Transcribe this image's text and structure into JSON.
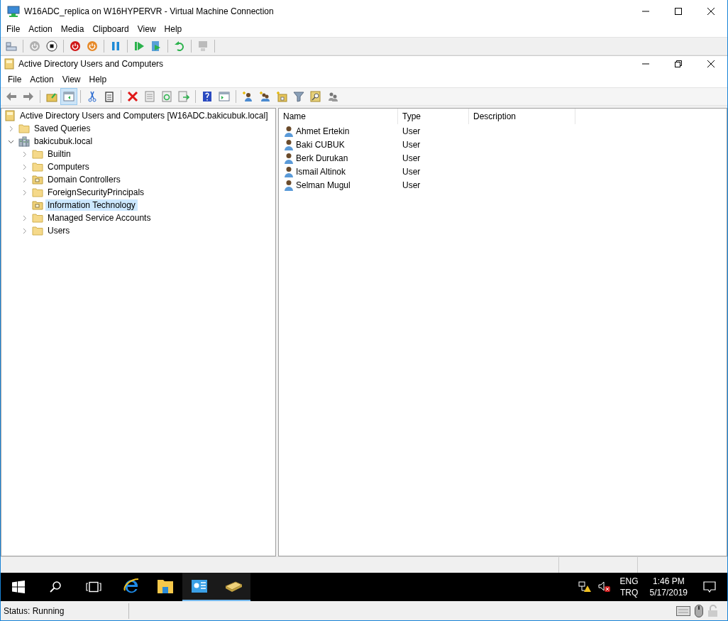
{
  "window": {
    "title": "W16ADC_replica on W16HYPERVR - Virtual Machine Connection"
  },
  "menu": [
    "File",
    "Action",
    "Media",
    "Clipboard",
    "View",
    "Help"
  ],
  "console": {
    "title": "Active Directory Users and Computers",
    "menu": [
      "File",
      "Action",
      "View",
      "Help"
    ]
  },
  "tree": [
    {
      "label": "Active Directory Users and Computers [W16ADC.bakicubuk.local]",
      "kind": "root",
      "selected": false,
      "children": [
        {
          "label": "Saved Queries",
          "kind": "folder",
          "expanded": false,
          "selected": false
        },
        {
          "label": "bakicubuk.local",
          "kind": "domain",
          "expanded": true,
          "selected": false,
          "children": [
            {
              "label": "Builtin",
              "kind": "folder",
              "expanded": false,
              "selected": false
            },
            {
              "label": "Computers",
              "kind": "folder",
              "expanded": false,
              "selected": false
            },
            {
              "label": "Domain Controllers",
              "kind": "ou",
              "expanded": false,
              "selected": false
            },
            {
              "label": "ForeignSecurityPrincipals",
              "kind": "folder",
              "expanded": false,
              "selected": false
            },
            {
              "label": "Information Technology",
              "kind": "ou",
              "selected": true
            },
            {
              "label": "Managed Service Accounts",
              "kind": "folder",
              "expanded": false,
              "selected": false
            },
            {
              "label": "Users",
              "kind": "folder",
              "expanded": false,
              "selected": false
            }
          ]
        }
      ]
    }
  ],
  "table": {
    "columns": [
      "Name",
      "Type",
      "Description"
    ],
    "rows": [
      {
        "name": "Ahmet Ertekin",
        "type": "User"
      },
      {
        "name": "Baki CUBUK",
        "type": "User"
      },
      {
        "name": "Berk Durukan",
        "type": "User"
      },
      {
        "name": "Ismail Altinok",
        "type": "User"
      },
      {
        "name": "Selman Mugul",
        "type": "User"
      }
    ]
  },
  "taskbar": {
    "apps": [
      {
        "kind": "browser",
        "active": false
      },
      {
        "kind": "explorer",
        "active": false
      },
      {
        "kind": "server-manager",
        "active": true
      },
      {
        "kind": "directory",
        "active": true
      }
    ],
    "language": [
      "ENG",
      "TRQ"
    ],
    "time": "1:46 PM",
    "date": "5/17/2019"
  },
  "status_bar": {
    "text": "Status: Running"
  }
}
